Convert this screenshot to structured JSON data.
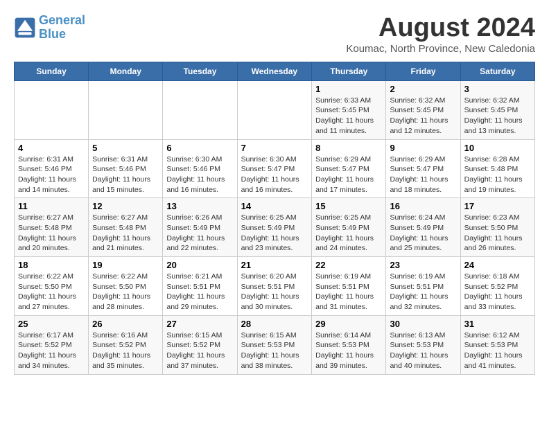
{
  "header": {
    "logo_line1": "General",
    "logo_line2": "Blue",
    "month_year": "August 2024",
    "location": "Koumac, North Province, New Caledonia"
  },
  "weekdays": [
    "Sunday",
    "Monday",
    "Tuesday",
    "Wednesday",
    "Thursday",
    "Friday",
    "Saturday"
  ],
  "weeks": [
    [
      {
        "day": "",
        "info": ""
      },
      {
        "day": "",
        "info": ""
      },
      {
        "day": "",
        "info": ""
      },
      {
        "day": "",
        "info": ""
      },
      {
        "day": "1",
        "info": "Sunrise: 6:33 AM\nSunset: 5:45 PM\nDaylight: 11 hours\nand 11 minutes."
      },
      {
        "day": "2",
        "info": "Sunrise: 6:32 AM\nSunset: 5:45 PM\nDaylight: 11 hours\nand 12 minutes."
      },
      {
        "day": "3",
        "info": "Sunrise: 6:32 AM\nSunset: 5:45 PM\nDaylight: 11 hours\nand 13 minutes."
      }
    ],
    [
      {
        "day": "4",
        "info": "Sunrise: 6:31 AM\nSunset: 5:46 PM\nDaylight: 11 hours\nand 14 minutes."
      },
      {
        "day": "5",
        "info": "Sunrise: 6:31 AM\nSunset: 5:46 PM\nDaylight: 11 hours\nand 15 minutes."
      },
      {
        "day": "6",
        "info": "Sunrise: 6:30 AM\nSunset: 5:46 PM\nDaylight: 11 hours\nand 16 minutes."
      },
      {
        "day": "7",
        "info": "Sunrise: 6:30 AM\nSunset: 5:47 PM\nDaylight: 11 hours\nand 16 minutes."
      },
      {
        "day": "8",
        "info": "Sunrise: 6:29 AM\nSunset: 5:47 PM\nDaylight: 11 hours\nand 17 minutes."
      },
      {
        "day": "9",
        "info": "Sunrise: 6:29 AM\nSunset: 5:47 PM\nDaylight: 11 hours\nand 18 minutes."
      },
      {
        "day": "10",
        "info": "Sunrise: 6:28 AM\nSunset: 5:48 PM\nDaylight: 11 hours\nand 19 minutes."
      }
    ],
    [
      {
        "day": "11",
        "info": "Sunrise: 6:27 AM\nSunset: 5:48 PM\nDaylight: 11 hours\nand 20 minutes."
      },
      {
        "day": "12",
        "info": "Sunrise: 6:27 AM\nSunset: 5:48 PM\nDaylight: 11 hours\nand 21 minutes."
      },
      {
        "day": "13",
        "info": "Sunrise: 6:26 AM\nSunset: 5:49 PM\nDaylight: 11 hours\nand 22 minutes."
      },
      {
        "day": "14",
        "info": "Sunrise: 6:25 AM\nSunset: 5:49 PM\nDaylight: 11 hours\nand 23 minutes."
      },
      {
        "day": "15",
        "info": "Sunrise: 6:25 AM\nSunset: 5:49 PM\nDaylight: 11 hours\nand 24 minutes."
      },
      {
        "day": "16",
        "info": "Sunrise: 6:24 AM\nSunset: 5:49 PM\nDaylight: 11 hours\nand 25 minutes."
      },
      {
        "day": "17",
        "info": "Sunrise: 6:23 AM\nSunset: 5:50 PM\nDaylight: 11 hours\nand 26 minutes."
      }
    ],
    [
      {
        "day": "18",
        "info": "Sunrise: 6:22 AM\nSunset: 5:50 PM\nDaylight: 11 hours\nand 27 minutes."
      },
      {
        "day": "19",
        "info": "Sunrise: 6:22 AM\nSunset: 5:50 PM\nDaylight: 11 hours\nand 28 minutes."
      },
      {
        "day": "20",
        "info": "Sunrise: 6:21 AM\nSunset: 5:51 PM\nDaylight: 11 hours\nand 29 minutes."
      },
      {
        "day": "21",
        "info": "Sunrise: 6:20 AM\nSunset: 5:51 PM\nDaylight: 11 hours\nand 30 minutes."
      },
      {
        "day": "22",
        "info": "Sunrise: 6:19 AM\nSunset: 5:51 PM\nDaylight: 11 hours\nand 31 minutes."
      },
      {
        "day": "23",
        "info": "Sunrise: 6:19 AM\nSunset: 5:51 PM\nDaylight: 11 hours\nand 32 minutes."
      },
      {
        "day": "24",
        "info": "Sunrise: 6:18 AM\nSunset: 5:52 PM\nDaylight: 11 hours\nand 33 minutes."
      }
    ],
    [
      {
        "day": "25",
        "info": "Sunrise: 6:17 AM\nSunset: 5:52 PM\nDaylight: 11 hours\nand 34 minutes."
      },
      {
        "day": "26",
        "info": "Sunrise: 6:16 AM\nSunset: 5:52 PM\nDaylight: 11 hours\nand 35 minutes."
      },
      {
        "day": "27",
        "info": "Sunrise: 6:15 AM\nSunset: 5:52 PM\nDaylight: 11 hours\nand 37 minutes."
      },
      {
        "day": "28",
        "info": "Sunrise: 6:15 AM\nSunset: 5:53 PM\nDaylight: 11 hours\nand 38 minutes."
      },
      {
        "day": "29",
        "info": "Sunrise: 6:14 AM\nSunset: 5:53 PM\nDaylight: 11 hours\nand 39 minutes."
      },
      {
        "day": "30",
        "info": "Sunrise: 6:13 AM\nSunset: 5:53 PM\nDaylight: 11 hours\nand 40 minutes."
      },
      {
        "day": "31",
        "info": "Sunrise: 6:12 AM\nSunset: 5:53 PM\nDaylight: 11 hours\nand 41 minutes."
      }
    ]
  ]
}
